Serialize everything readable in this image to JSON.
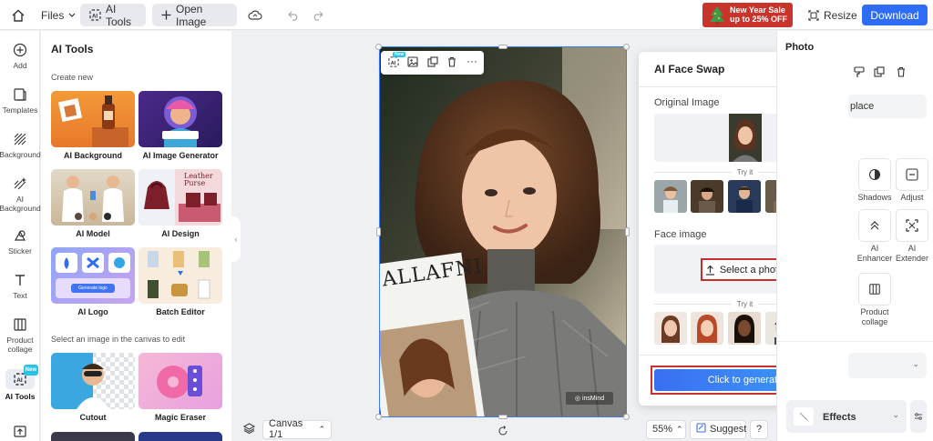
{
  "topbar": {
    "files_label": "Files",
    "ai_tools_label": "AI Tools",
    "open_image_label": "Open Image",
    "promo_line1": "New Year Sale",
    "promo_line2": "up to 25% OFF",
    "resize_label": "Resize",
    "download_label": "Download"
  },
  "rail": {
    "items": [
      {
        "label": "Add",
        "icon": "plus-circle-icon"
      },
      {
        "label": "Templates",
        "icon": "templates-icon"
      },
      {
        "label": "Background",
        "icon": "background-icon"
      },
      {
        "label": "AI Background",
        "icon": "ai-background-icon"
      },
      {
        "label": "Sticker",
        "icon": "sticker-icon"
      },
      {
        "label": "Text",
        "icon": "text-icon"
      },
      {
        "label": "Product collage",
        "icon": "collage-icon"
      },
      {
        "label": "AI Tools",
        "icon": "ai-tools-icon",
        "badge": "New"
      },
      {
        "label": "",
        "icon": "upload-icon"
      }
    ]
  },
  "panel": {
    "title": "AI Tools",
    "create_new": "Create new",
    "select_hint": "Select an image in the canvas to edit",
    "cards": [
      {
        "label": "AI Background"
      },
      {
        "label": "AI Image Generator"
      },
      {
        "label": "AI Model"
      },
      {
        "label": "AI Design"
      },
      {
        "label": "AI Logo"
      },
      {
        "label": "Batch Editor"
      },
      {
        "label": "Cutout"
      },
      {
        "label": "Magic Eraser"
      }
    ],
    "ai_design_text": "Leather Purse",
    "ai_logo_button": "Generate logo"
  },
  "canvas": {
    "toolbar_badge": "New",
    "photo_text": "ALLAFNI",
    "watermark": "insMind",
    "canvas_label": "Canvas 1/1",
    "zoom": "55%",
    "suggest_label": "Suggest",
    "help_label": "?"
  },
  "modal": {
    "title": "AI Face Swap",
    "original_image_label": "Original Image",
    "try_it_1": "Try it",
    "face_image_label": "Face image",
    "select_photo_label": "Select a photo",
    "try_it_2": "Try it",
    "generate_label": "Click to generate"
  },
  "rpanel": {
    "title": "Photo",
    "replace_label": "place",
    "tools": [
      {
        "label": "Shadows"
      },
      {
        "label": "Adjust"
      },
      {
        "label": "AI Enhancer"
      },
      {
        "label": "AI Extender"
      },
      {
        "label": "Product collage"
      }
    ],
    "effects_label": "Effects"
  },
  "colors": {
    "accent": "#2f6cf6",
    "highlight": "#c9302c",
    "promo": "#c8332b"
  }
}
